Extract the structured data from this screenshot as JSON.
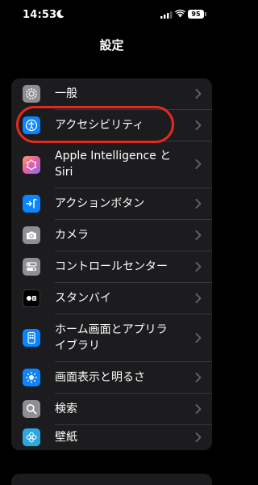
{
  "status_bar": {
    "time": "14:53",
    "battery": "95"
  },
  "nav": {
    "title": "設定"
  },
  "settings": [
    {
      "label": "一般",
      "icon": "gear-icon",
      "color": "#8e8e93"
    },
    {
      "label": "アクセシビリティ",
      "icon": "accessibility-icon",
      "color": "#0a84ff"
    },
    {
      "label": "Apple Intelligence と Siri",
      "icon": "apple-intelligence-icon",
      "color": "#c86dd7"
    },
    {
      "label": "アクションボタン",
      "icon": "action-button-icon",
      "color": "#0a84ff"
    },
    {
      "label": "カメラ",
      "icon": "camera-icon",
      "color": "#8e8e93"
    },
    {
      "label": "コントロールセンター",
      "icon": "control-center-icon",
      "color": "#8e8e93"
    },
    {
      "label": "スタンバイ",
      "icon": "standby-icon",
      "color": "#000000"
    },
    {
      "label": "ホーム画面とアプリライブラリ",
      "icon": "home-screen-icon",
      "color": "#0a84ff"
    },
    {
      "label": "画面表示と明るさ",
      "icon": "brightness-icon",
      "color": "#0a84ff"
    },
    {
      "label": "検索",
      "icon": "search-icon",
      "color": "#8e8e93"
    },
    {
      "label": "壁紙",
      "icon": "wallpaper-icon",
      "color": "#2fa8e0"
    }
  ]
}
